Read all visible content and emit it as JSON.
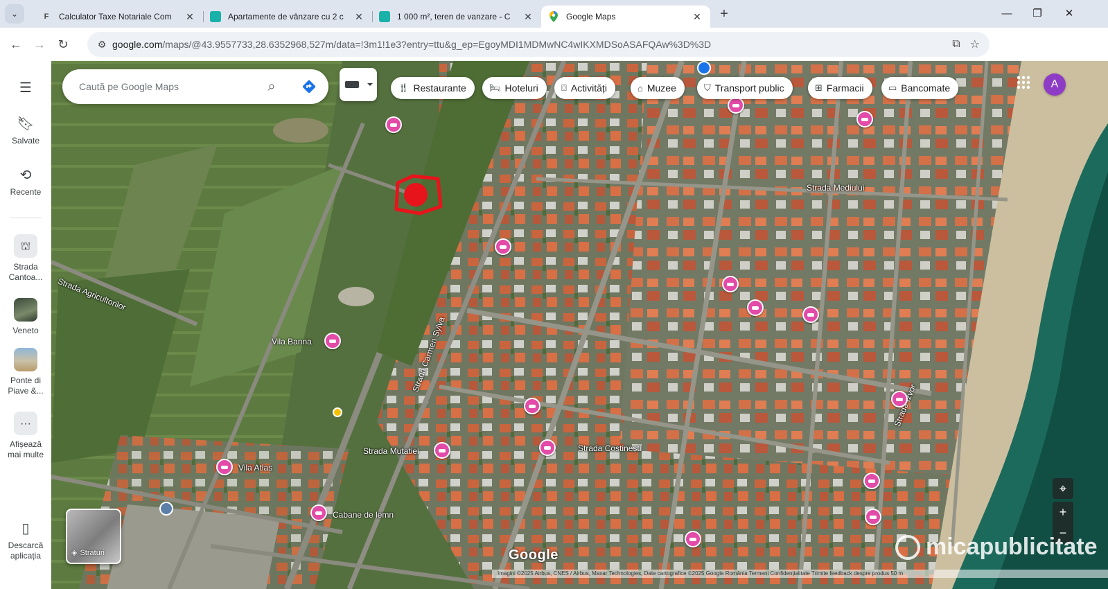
{
  "browser": {
    "tabs": [
      {
        "title": "Calculator Taxe Notariale Com",
        "active": false,
        "favicon_color": "#4a4a4a"
      },
      {
        "title": "Apartamente de vânzare cu 2 c",
        "active": false,
        "favicon_color": "#1ab2a8"
      },
      {
        "title": "1 000 m², teren de vanzare - C",
        "active": false,
        "favicon_color": "#1ab2a8"
      },
      {
        "title": "Google Maps",
        "active": true,
        "favicon_color": "#34a853"
      }
    ],
    "url_host": "google.com",
    "url_path": "/maps/@43.9557733,28.6352968,527m/data=!3m1!1e3?entry=ttu&g_ep=EgoyMDI1MDMwNC4wIKXMDSoASAFQAw%3D%3D",
    "profile_initial": "A"
  },
  "rail": {
    "saved": "Salvate",
    "recent": "Recente",
    "recent_places": [
      {
        "label_line1": "Strada",
        "label_line2": "Cantoa..."
      },
      {
        "label_line1": "Veneto",
        "label_line2": ""
      },
      {
        "label_line1": "Ponte di",
        "label_line2": "Piave &..."
      }
    ],
    "more_line1": "Afișează",
    "more_line2": "mai multe",
    "download_line1": "Descarcă",
    "download_line2": "aplicația"
  },
  "map": {
    "search_placeholder": "Caută pe Google Maps",
    "chips": [
      "Restaurante",
      "Hoteluri",
      "Activități",
      "Muzee",
      "Transport public",
      "Farmacii",
      "Bancomate"
    ],
    "street_labels": [
      "Strada Agricultorilor",
      "Strada Mediului",
      "Strada Carmen Sylva",
      "Strada Costinești",
      "Strada Mutatiei",
      "Strada Izvor"
    ],
    "place_labels": [
      "Vila Banna",
      "Cabane de lemn",
      "Vila Atlas"
    ],
    "layers_label": "Straturi",
    "google_logo": "Google",
    "watermark": "micapublicitate",
    "attribution": "Imagini ©2025 Airbus, CNES / Airbus, Maxar Technologies, Date cartografice ©2025 Google   România   Termeni   Confidențialitate   Trimite feedback despre produs   50 m"
  },
  "colors": {
    "accent_blue": "#1a73e8",
    "pin_pink": "#e24ba7",
    "marker_red": "#e8141c",
    "avatar_purple": "#8e3bc5"
  }
}
